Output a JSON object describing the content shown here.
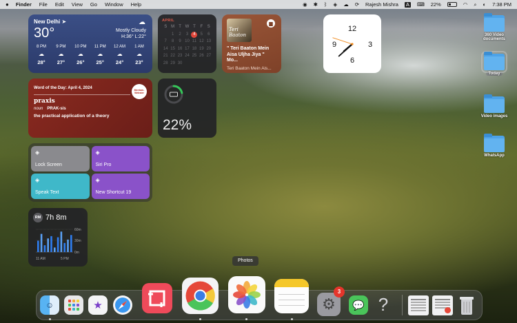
{
  "menubar": {
    "apple": "",
    "app": "Finder",
    "menus": [
      "File",
      "Edit",
      "View",
      "Go",
      "Window",
      "Help"
    ],
    "user": "Rajesh Mishra",
    "battery_pct": "22%",
    "time": "7:38 PM",
    "input_source": "A"
  },
  "weather": {
    "city": "New Delhi",
    "temp": "30°",
    "condition": "Mostly Cloudy",
    "hilo": "H:36° L:22°",
    "hours": [
      {
        "time": "8 PM",
        "temp": "28°"
      },
      {
        "time": "9 PM",
        "temp": "27°"
      },
      {
        "time": "10 PM",
        "temp": "26°"
      },
      {
        "time": "11 PM",
        "temp": "25°"
      },
      {
        "time": "12 AM",
        "temp": "24°"
      },
      {
        "time": "1 AM",
        "temp": "23°"
      }
    ]
  },
  "calendar": {
    "month": "APRIL",
    "dow": [
      "S",
      "M",
      "T",
      "W",
      "T",
      "F",
      "S"
    ],
    "today": 4
  },
  "spotify": {
    "art_text": "Teri Baaton",
    "song": "\" Teri Baaton Mein Aisa Uljha Jiya \" Mo...",
    "artist": "Teri Baaton Mein Ais..."
  },
  "clock": {
    "hours": 7,
    "minutes": 38,
    "seconds": 48,
    "numerals": [
      "12",
      "3",
      "6",
      "9"
    ]
  },
  "word": {
    "header": "Word of the Day: April 4, 2024",
    "badge": "Merriam-Webster",
    "term": "praxis",
    "pos": "noun",
    "pronunciation": "PRAK-sis",
    "definition": "the practical application of a theory"
  },
  "battery": {
    "percent": "22%",
    "level": 0.22
  },
  "shortcuts": [
    {
      "label": "Lock Screen",
      "color": "#8a8a8e"
    },
    {
      "label": "Siri Pro",
      "color": "#8a52c9"
    },
    {
      "label": "Speak Text",
      "color": "#3fb8c9"
    },
    {
      "label": "New Shortcut 19",
      "color": "#8a52c9"
    }
  ],
  "screentime": {
    "initials": "RM",
    "total": "7h 8m",
    "y_labels": [
      "60m",
      "30m",
      "0m"
    ],
    "x_labels": [
      "11 AM",
      "5 PM"
    ],
    "bars": [
      0.5,
      0.8,
      0.3,
      0.6,
      0.7,
      0.2,
      0.65,
      0.9,
      0.4,
      0.55,
      0.75
    ]
  },
  "desktop": [
    {
      "label": "360 Video documents",
      "selected": false
    },
    {
      "label": "Today",
      "selected": true
    },
    {
      "label": "Video images",
      "selected": false
    },
    {
      "label": "WhatsApp",
      "selected": false
    }
  ],
  "tooltip": "Photos",
  "dock": {
    "settings_badge": "3"
  }
}
